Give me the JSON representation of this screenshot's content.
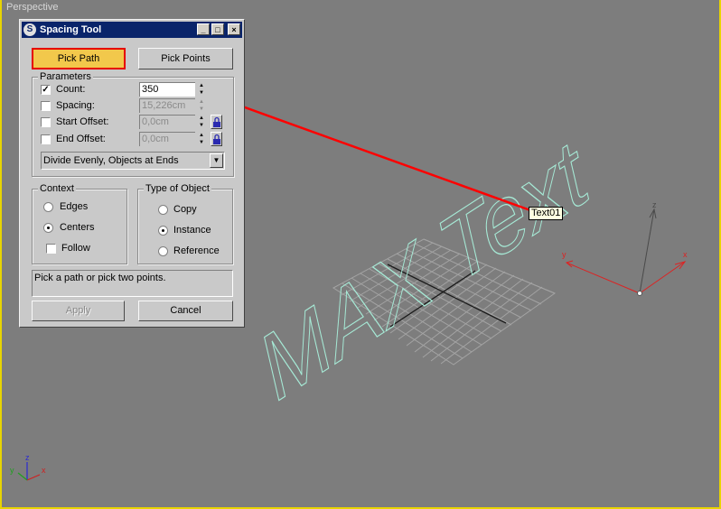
{
  "viewport": {
    "label": "Perspective",
    "scene_text": "MAX Text",
    "tooltip": "Text01",
    "gizmo_axes": {
      "x": "x",
      "y": "y",
      "z": "z"
    },
    "corner_axes": {
      "x": "x",
      "y": "y",
      "z": "z"
    },
    "colors": {
      "background": "#7d7d7d",
      "path_line": "#ff0000",
      "text_spline": "#a6ead6",
      "border": "#e8d400"
    }
  },
  "dialog": {
    "title": "Spacing Tool",
    "window_buttons": {
      "minimize": "_",
      "maximize": "□",
      "close": "×"
    },
    "pick_path": "Pick Path",
    "pick_points": "Pick Points",
    "parameters": {
      "label": "Parameters",
      "count": {
        "label": "Count:",
        "value": "350",
        "checked": true
      },
      "spacing": {
        "label": "Spacing:",
        "value": "15,226cm",
        "checked": false
      },
      "start_offset": {
        "label": "Start Offset:",
        "value": "0,0cm",
        "checked": false
      },
      "end_offset": {
        "label": "End Offset:",
        "value": "0,0cm",
        "checked": false
      },
      "distribution": "Divide Evenly, Objects at Ends"
    },
    "context": {
      "label": "Context",
      "edges": "Edges",
      "centers": "Centers",
      "follow": "Follow",
      "selected": "Centers"
    },
    "type_of_object": {
      "label": "Type of Object",
      "copy": "Copy",
      "instance": "Instance",
      "reference": "Reference",
      "selected": "Instance"
    },
    "status": "Pick a path or pick two points.",
    "apply": "Apply",
    "cancel": "Cancel",
    "colors": {
      "pick_path_active": "#f2c84b",
      "pick_path_border": "#e60000",
      "title_bar": "#0a246a"
    }
  }
}
